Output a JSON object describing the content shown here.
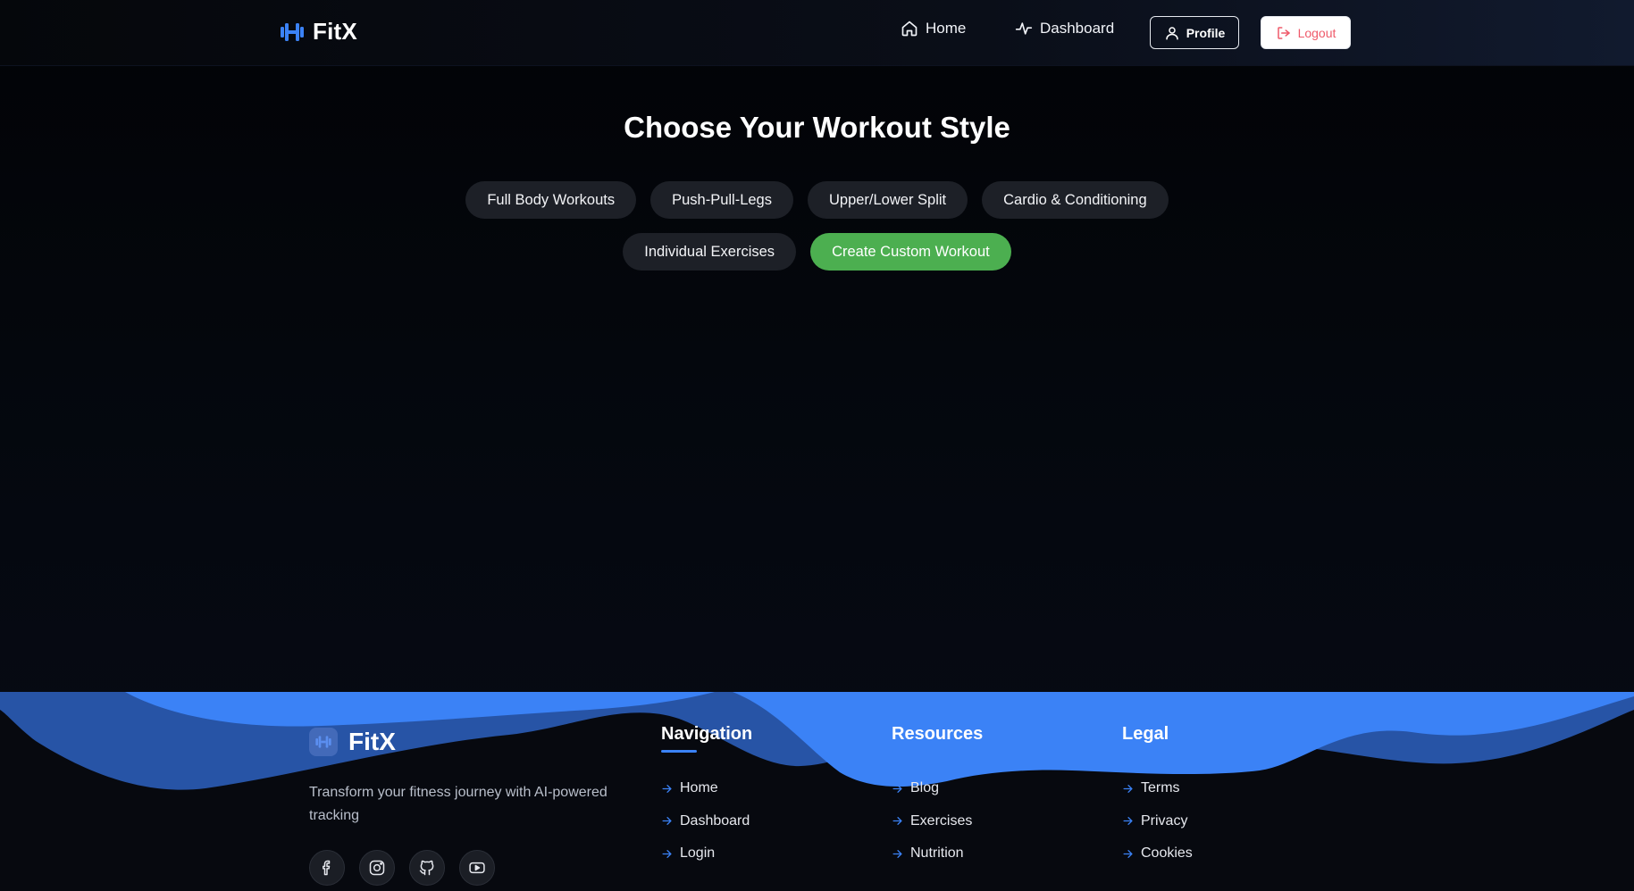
{
  "header": {
    "brand": "FitX",
    "nav": [
      {
        "label": "Home",
        "icon": "home-icon"
      },
      {
        "label": "Dashboard",
        "icon": "activity-icon"
      }
    ],
    "profile_label": "Profile",
    "logout_label": "Logout"
  },
  "main": {
    "title": "Choose Your Workout Style",
    "chips_row1": [
      "Full Body Workouts",
      "Push-Pull-Legs",
      "Upper/Lower Split",
      "Cardio & Conditioning"
    ],
    "chips_row2": [
      "Individual Exercises",
      "Create Custom Workout"
    ],
    "accent_chip": "Create Custom Workout"
  },
  "footer": {
    "brand": "FitX",
    "tagline": "Transform your fitness journey with AI-powered tracking",
    "socials": [
      "facebook-icon",
      "instagram-icon",
      "github-icon",
      "youtube-icon"
    ],
    "columns": [
      {
        "title": "Navigation",
        "links": [
          "Home",
          "Dashboard",
          "Login"
        ]
      },
      {
        "title": "Resources",
        "links": [
          "Blog",
          "Exercises",
          "Nutrition"
        ]
      },
      {
        "title": "Legal",
        "links": [
          "Terms",
          "Privacy",
          "Cookies"
        ]
      }
    ]
  },
  "colors": {
    "accent_blue": "#3b82f6",
    "accent_green": "#4caf50",
    "logout_red": "#ef5a6a",
    "chip_bg": "#1d2027"
  }
}
